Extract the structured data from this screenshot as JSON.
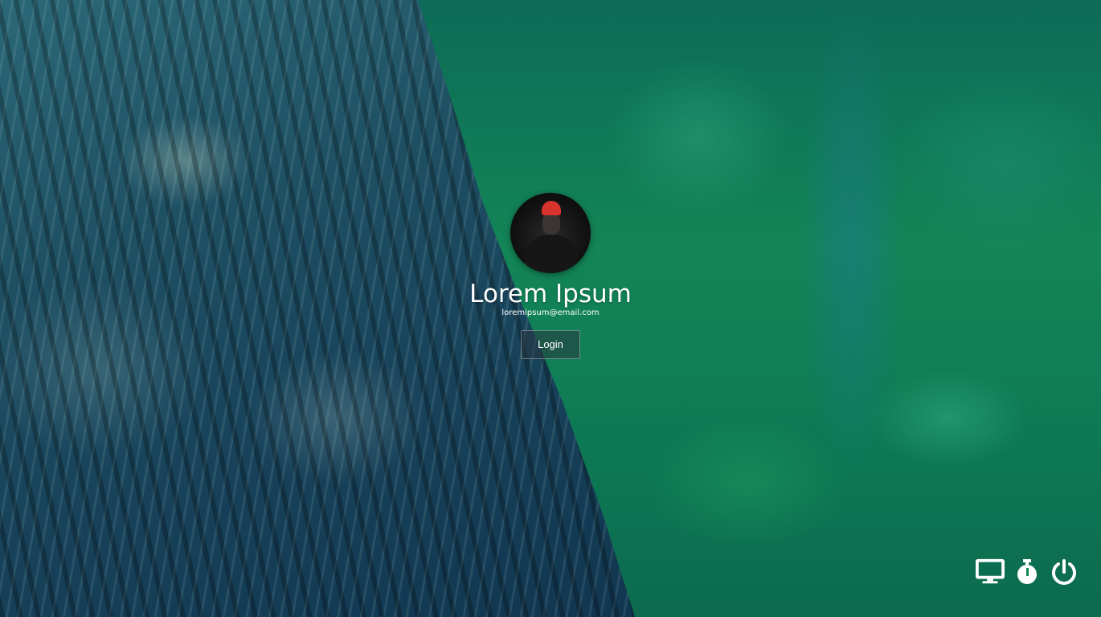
{
  "user": {
    "name": "Lorem Ipsum",
    "email": "loremipsum@email.com",
    "avatar_icon": "user-avatar-photo"
  },
  "actions": {
    "login_label": "Login"
  },
  "system_tray": {
    "items": [
      {
        "icon": "monitor-icon",
        "label": "Display"
      },
      {
        "icon": "timer-icon",
        "label": "Suspend"
      },
      {
        "icon": "power-icon",
        "label": "Power"
      }
    ]
  },
  "colors": {
    "text": "#ffffff",
    "background_green": "#138557",
    "trunk_blue": "#1e4f63",
    "beanie_red": "#d9332e"
  }
}
